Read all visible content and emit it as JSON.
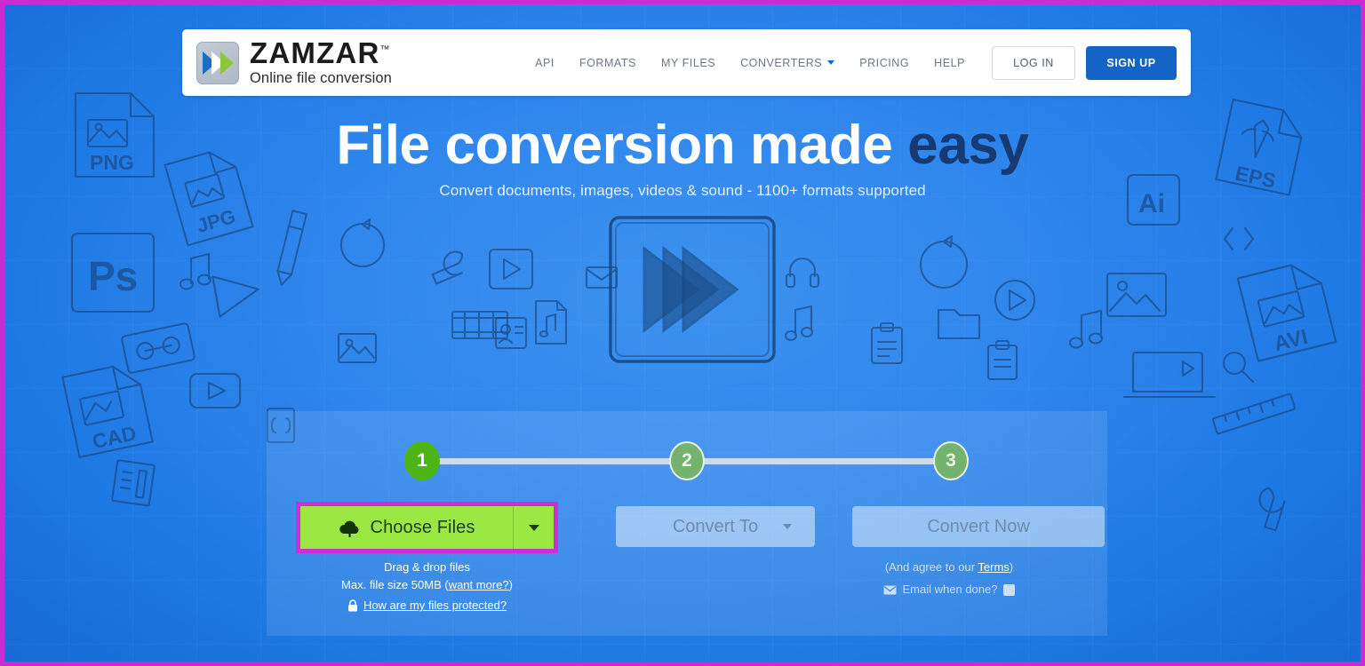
{
  "brand": {
    "name": "ZAMZAR",
    "tm": "™",
    "tagline": "Online file conversion",
    "logo_icon": "double-chevron-icon"
  },
  "nav": {
    "items": [
      {
        "label": "API",
        "caret": false
      },
      {
        "label": "FORMATS",
        "caret": false
      },
      {
        "label": "MY FILES",
        "caret": false
      },
      {
        "label": "CONVERTERS",
        "caret": true
      },
      {
        "label": "PRICING",
        "caret": false
      },
      {
        "label": "HELP",
        "caret": false
      }
    ],
    "login_label": "LOG IN",
    "signup_label": "SIGN UP"
  },
  "hero": {
    "headline_plain": "File conversion made ",
    "headline_accent": "easy",
    "subhead": "Convert documents, images, videos & sound - 1100+ formats supported",
    "center_icon": "fast-forward-sketch-icon"
  },
  "widget": {
    "steps": [
      {
        "number": "1",
        "state": "active"
      },
      {
        "number": "2",
        "state": "idle"
      },
      {
        "number": "3",
        "state": "idle"
      }
    ],
    "choose_files": {
      "label": "Choose Files",
      "icon": "cloud-upload-icon",
      "dropdown_icon": "caret-down-icon",
      "highlight_color": "#cf2ed6",
      "button_color": "#9ce843"
    },
    "convert_to": {
      "label": "Convert To",
      "dropdown_icon": "caret-down-icon",
      "disabled": true
    },
    "convert_now": {
      "label": "Convert Now",
      "disabled": true
    },
    "help_left": {
      "drag_drop": "Drag & drop files",
      "max_size_prefix": "Max. file size 50MB (",
      "want_more": "want more?",
      "max_size_suffix": ")",
      "protected_link": "How are my files protected?",
      "lock_icon": "lock-icon"
    },
    "help_right": {
      "agree_prefix": "(And agree to our ",
      "terms_link": "Terms",
      "agree_suffix": ")",
      "email_label": "Email when done?",
      "envelope_icon": "envelope-icon",
      "checkbox_checked": false
    }
  },
  "background": {
    "doodle_labels": [
      "PNG",
      "JPG",
      "Ps",
      "EPS",
      "Ai",
      "AVI",
      "CAD"
    ],
    "accent_blue": "#1f7ae0",
    "annotation_color": "#cc2bd4"
  }
}
